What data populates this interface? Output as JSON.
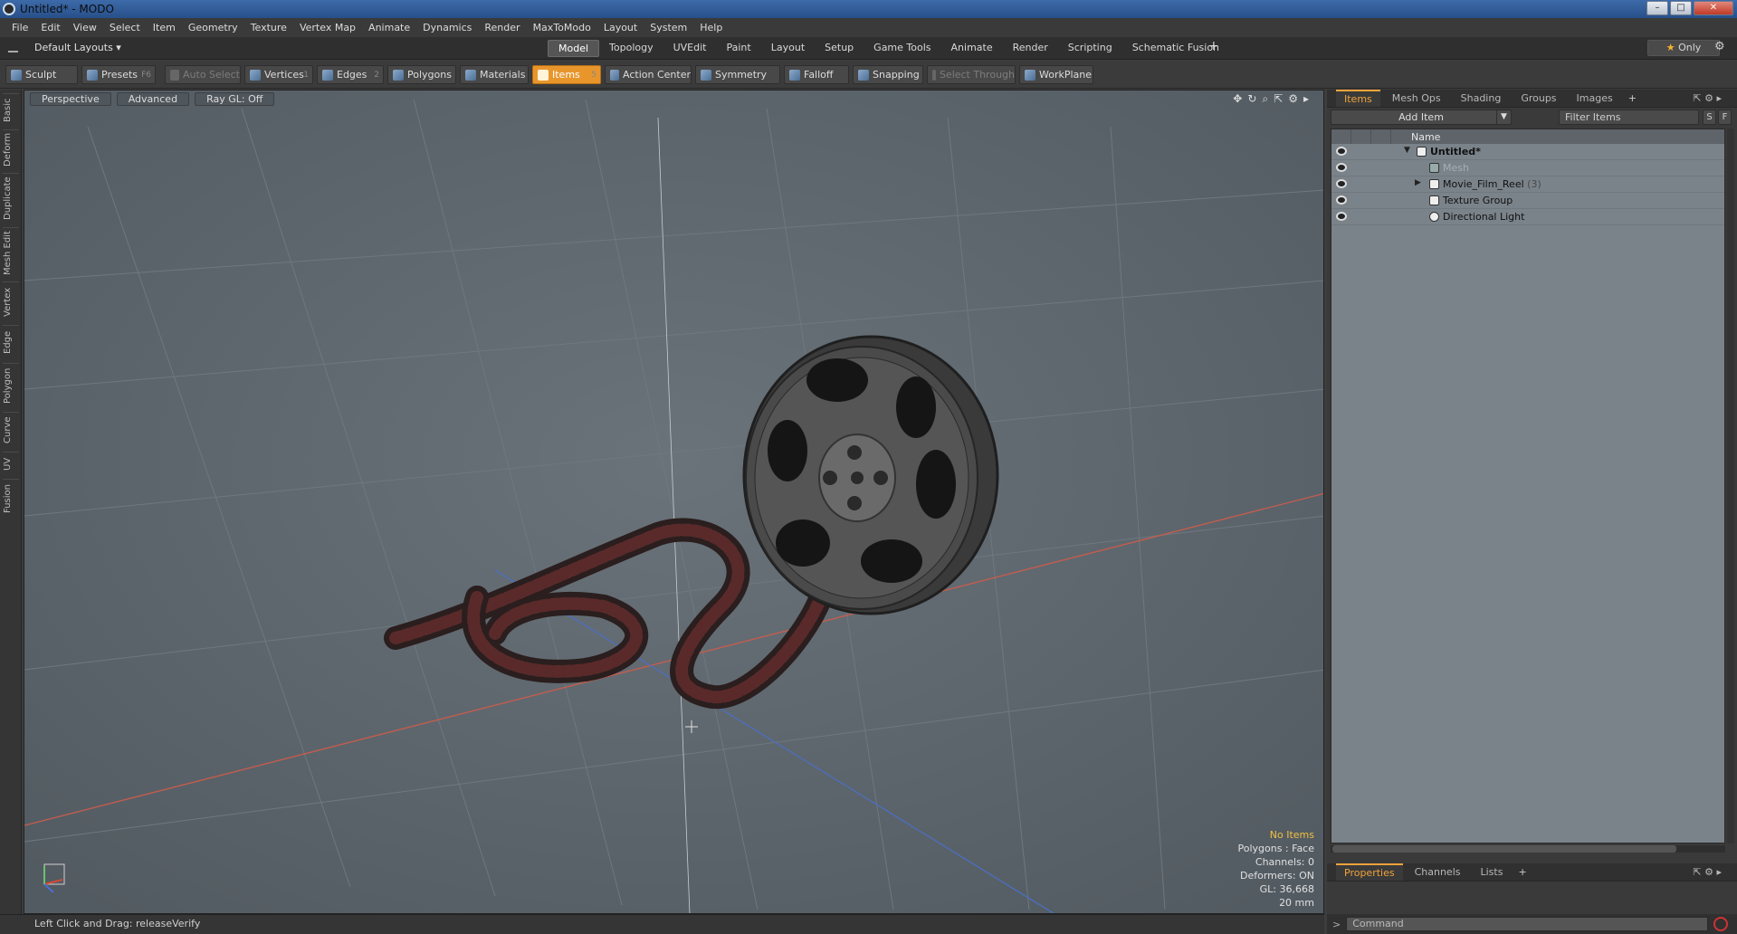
{
  "window": {
    "title": "Untitled* - MODO"
  },
  "menu": [
    "File",
    "Edit",
    "View",
    "Select",
    "Item",
    "Geometry",
    "Texture",
    "Vertex Map",
    "Animate",
    "Dynamics",
    "Render",
    "MaxToModo",
    "Layout",
    "System",
    "Help"
  ],
  "layouts": {
    "label": "Default Layouts ▾"
  },
  "tabs": [
    {
      "label": "Model",
      "active": true
    },
    {
      "label": "Topology"
    },
    {
      "label": "UVEdit"
    },
    {
      "label": "Paint"
    },
    {
      "label": "Layout"
    },
    {
      "label": "Setup"
    },
    {
      "label": "Game Tools"
    },
    {
      "label": "Animate"
    },
    {
      "label": "Render"
    },
    {
      "label": "Scripting"
    },
    {
      "label": "Schematic Fusion"
    }
  ],
  "only_label": "Only",
  "toolbar": {
    "sculpt": "Sculpt",
    "presets": "Presets",
    "presets_key": "F6",
    "auto_select": "Auto Select",
    "vertices": "Vertices",
    "vertices_key": "1",
    "edges": "Edges",
    "edges_key": "2",
    "polygons": "Polygons",
    "materials": "Materials",
    "items": "Items",
    "items_key": "5",
    "action_center": "Action Center",
    "symmetry": "Symmetry",
    "falloff": "Falloff",
    "snapping": "Snapping",
    "select_through": "Select Through",
    "workplane": "WorkPlane"
  },
  "left_tabs": [
    "Basic",
    "Deform",
    "Duplicate",
    "Mesh Edit",
    "Vertex",
    "Edge",
    "Polygon",
    "Curve",
    "UV",
    "Fusion"
  ],
  "viewport": {
    "view_mode": "Perspective",
    "advanced": "Advanced",
    "raygl": "Ray GL: Off",
    "info": {
      "no_items": "No Items",
      "polygons": "Polygons : Face",
      "channels": "Channels: 0",
      "deformers": "Deformers: ON",
      "gl": "GL: 36,668",
      "scale": "20 mm"
    }
  },
  "status": {
    "text": "Left Click and Drag:   releaseVerify"
  },
  "items_panel": {
    "tabs": [
      "Items",
      "Mesh Ops",
      "Shading",
      "Groups",
      "Images"
    ],
    "add_item": "Add Item",
    "filter": "Filter Items",
    "filter_s": "S",
    "filter_f": "F",
    "column_name": "Name",
    "tree": [
      {
        "label": "Untitled*",
        "indent": 0
      },
      {
        "label": "Mesh",
        "indent": 1
      },
      {
        "label": "Movie_Film_Reel",
        "count": "(3)",
        "indent": 1
      },
      {
        "label": "Texture Group",
        "indent": 1
      },
      {
        "label": "Directional Light",
        "indent": 1
      }
    ]
  },
  "properties_panel": {
    "tabs": [
      "Properties",
      "Channels",
      "Lists"
    ]
  },
  "command": {
    "placeholder": "Command"
  }
}
